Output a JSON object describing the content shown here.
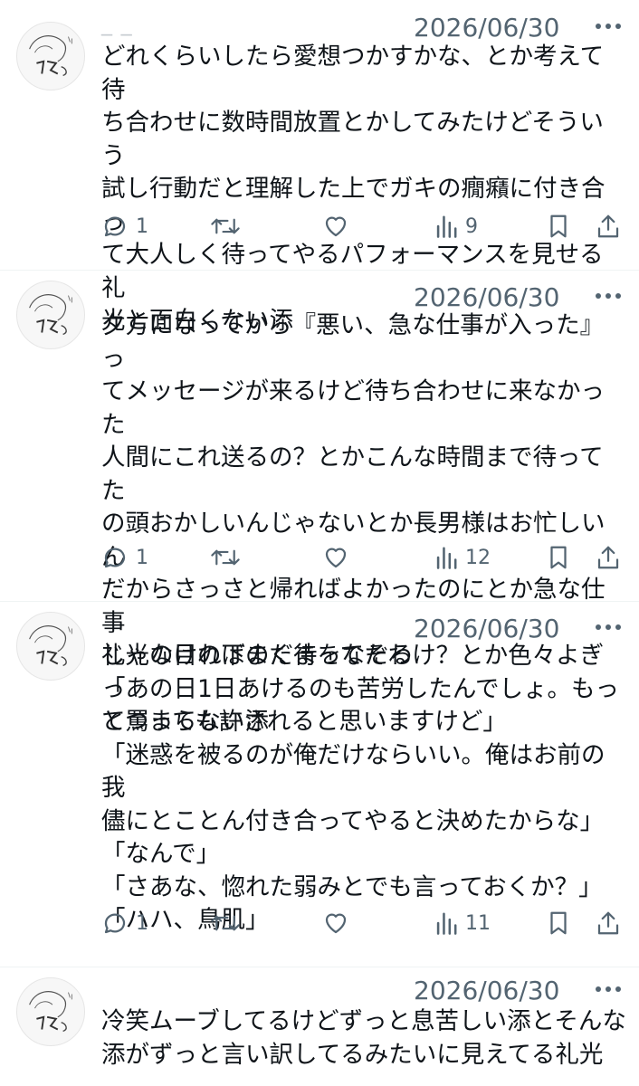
{
  "timeline": {
    "posts": [
      {
        "handle": "_ _",
        "date": "2026/06/30",
        "text": "どれくらいしたら愛想つかすかな、とか考えて待\nち合わせに数時間放置とかしてみたけどそういう\n試し行動だと理解した上でガキの癇癪に付き合っ\nて大人しく待ってやるパフォーマンスを見せる礼\n光と面白くない添",
        "replies": "1",
        "reposts": "",
        "likes": "",
        "views": "9"
      },
      {
        "handle": "",
        "date": "2026/06/30",
        "text": "夕方になってから『悪い、急な仕事が入った』っ\nてメッセージが来るけど待ち合わせに来なかった\n人間にこれ送るの？とかこんな時間まで待ってた\nの頭おかしいんじゃないとか長男様はお忙しいん\nだからさっさと帰ればよかったのにとか急な仕事\nじゃなければまだ待ってたわけ？とか色々よぎっ\nてつまらない添",
        "replies": "1",
        "reposts": "",
        "likes": "",
        "views": "12"
      },
      {
        "handle": "",
        "date": "2026/06/30",
        "text": "礼光の目の下のくまをなぞる\n「あの日1日あけるのも苦労したんでしょ。もっ\nと罵っても許されると思いますけど」\n「迷惑を被るのが俺だけならいい。俺はお前の我\n儘にとことん付き合ってやると決めたからな」\n「なんで」\n「さあな、惚れた弱みとでも言っておくか？」\n「ハハ、鳥肌」",
        "replies": "1",
        "reposts": "",
        "likes": "",
        "views": "11"
      },
      {
        "handle": "",
        "date": "2026/06/30",
        "text": "冷笑ムーブしてるけどずっと息苦しい添とそんな\n添がずっと言い訳してるみたいに見えてる礼光"
      }
    ]
  },
  "icons": {
    "reply": "speech-bubble-icon",
    "repost": "repost-arrows-icon",
    "like": "heart-icon",
    "views": "bar-chart-icon",
    "bookmark": "bookmark-icon",
    "share": "share-upload-icon",
    "more": "three-dots-icon"
  },
  "colors": {
    "icon_gray": "#536471",
    "text": "#0f1419",
    "divider": "#eff3f4"
  }
}
